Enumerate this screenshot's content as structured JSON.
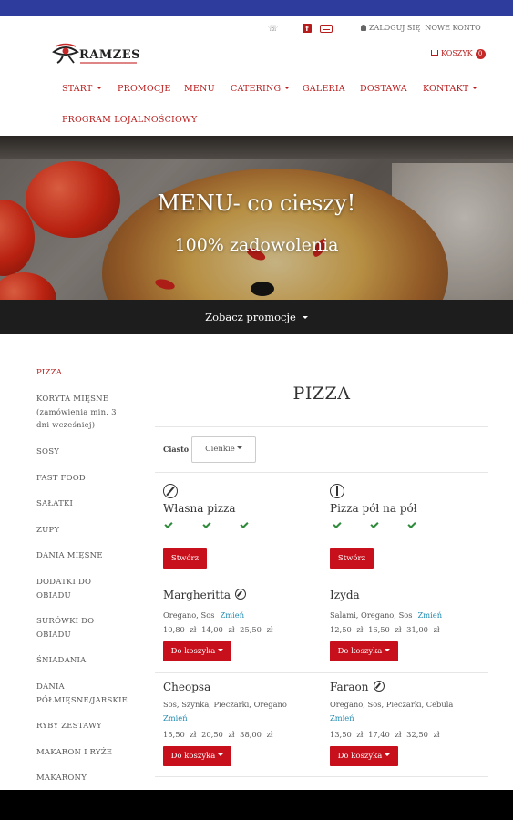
{
  "topbar": {
    "phone_icon": "phone-icon",
    "facebook_icon": "facebook-icon",
    "mail_icon": "mail-icon",
    "login": "ZALOGUJ SIĘ",
    "new_account": "NOWE KONTO"
  },
  "logo": {
    "name": "RAMZES"
  },
  "cart": {
    "label": "KOSZYK",
    "count": "0"
  },
  "nav": {
    "start": "START",
    "promocje": "PROMOCJE",
    "menu": "MENU",
    "catering": "CATERING",
    "galeria": "GALERIA",
    "dostawa": "DOSTAWA",
    "kontakt": "KONTAKT",
    "loyalty": "PROGRAM LOJALNOŚCIOWY"
  },
  "hero": {
    "title": "MENU- co cieszy!",
    "subtitle": "100% zadowolenia"
  },
  "promo_bar": {
    "label": "Zobacz promocje"
  },
  "sidebar": {
    "items": [
      "PIZZA",
      "KORYTA MIĘSNE (zamówienia min. 3 dni wcześniej)",
      "SOSY",
      "FAST FOOD",
      "SAŁATKI",
      "ZUPY",
      "DANIA MIĘSNE",
      "DODATKI DO OBIADU",
      "SURÓWKI DO OBIADU",
      "ŚNIADANIA",
      "DANIA PÓŁMIĘSNE/JARSKIE",
      "RYBY ZESTAWY",
      "MAKARON I RYŻE",
      "MAKARONY"
    ]
  },
  "main": {
    "title": "PIZZA",
    "dough_label": "Ciasto",
    "dough_value": "Cienkie",
    "custom": [
      {
        "name": "Własna pizza",
        "button": "Stwórz"
      },
      {
        "name": "Pizza pół na pół",
        "button": "Stwórz"
      }
    ],
    "products": [
      {
        "name": "Margheritta",
        "ingredients": "Oregano, Sos",
        "change": "Zmień",
        "prices": "10,80 zł 14,00 zł 25,50 zł",
        "button": "Do koszyka"
      },
      {
        "name": "Izyda",
        "ingredients": "Salami, Oregano, Sos",
        "change": "Zmień",
        "prices": "12,50 zł 16,50 zł 31,00 zł",
        "button": "Do koszyka"
      },
      {
        "name": "Cheopsa",
        "ingredients": "Sos, Szynka, Pieczarki, Oregano",
        "change": "Zmień",
        "prices": "15,50 zł 20,50 zł 38,00 zł",
        "button": "Do koszyka"
      },
      {
        "name": "Faraon",
        "ingredients": "Oregano, Sos, Pieczarki, Cebula",
        "change": "Zmień",
        "prices": "13,50 zł 17,40 zł 32,50 zł",
        "button": "Do koszyka"
      }
    ]
  },
  "colors": {
    "brand_red": "#b71c1c",
    "button_red": "#c8101c",
    "link_blue": "#1f8ab0",
    "status_bar": "#2e3c9e"
  }
}
